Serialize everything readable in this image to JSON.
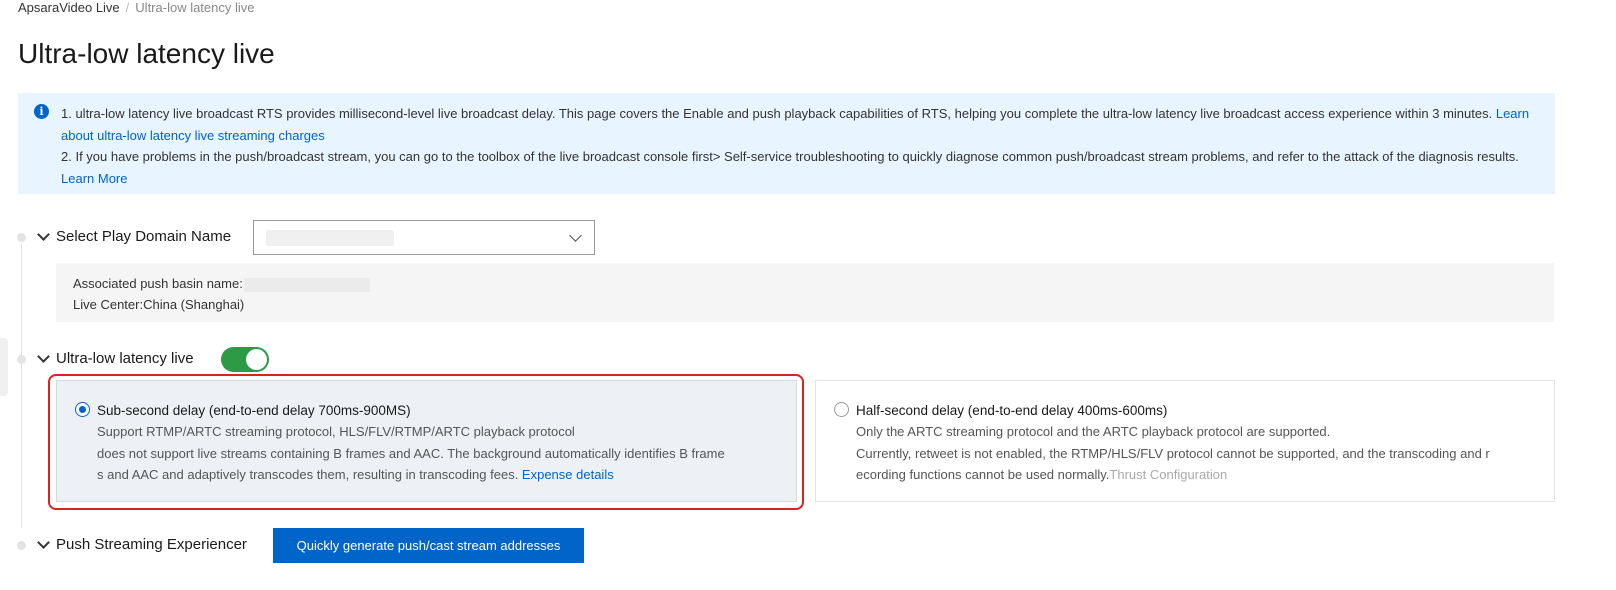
{
  "breadcrumb": {
    "root": "ApsaraVideo Live",
    "separator": "/",
    "current": "Ultra-low latency live"
  },
  "page_title": "Ultra-low latency live",
  "notice": {
    "line1": "1. ultra-low latency live broadcast RTS provides millisecond-level live broadcast delay. This page covers the Enable and push playback capabilities of RTS, helping you complete the ultra-low latency live broadcast access experience within 3 minutes. ",
    "line1_link": "Learn about ultra-low latency live streaming charges",
    "line2": "2. If you have problems in the push/broadcast stream, you can go to the toolbox of the live broadcast console first> Self-service troubleshooting to quickly diagnose common push/broadcast stream problems, and refer to the attack of the diagnosis results. ",
    "line2_link": "Learn More"
  },
  "domain_section": {
    "label": "Select Play Domain Name",
    "associated_label": "Associated push basin name:",
    "live_center": "Live Center:China (Shanghai)"
  },
  "latency_section": {
    "label": "Ultra-low latency live",
    "enabled": true,
    "options": [
      {
        "title": "Sub-second delay (end-to-end delay 700ms-900MS)",
        "desc1": "Support RTMP/ARTC streaming protocol, HLS/FLV/RTMP/ARTC playback protocol",
        "desc2": "does not support live streams containing B frames and AAC. The background automatically identifies B frame",
        "desc3": "s and AAC and adaptively transcodes them, resulting in transcoding fees. ",
        "link": "Expense details",
        "selected": true
      },
      {
        "title": "Half-second delay (end-to-end delay 400ms-600ms)",
        "desc1": "Only the ARTC streaming protocol and the ARTC playback protocol are supported.",
        "desc2": "Currently, retweet is not enabled, the RTMP/HLS/FLV protocol cannot be supported, and the transcoding and r",
        "desc3": "ecording functions cannot be used normally.",
        "link": "Thrust Configuration",
        "selected": false
      }
    ]
  },
  "push_section": {
    "label": "Push Streaming Experiencer",
    "button": "Quickly generate push/cast stream addresses"
  },
  "colors": {
    "primary": "#0064c8",
    "toggle_on": "#2d9b45",
    "highlight": "#e02020",
    "notice_bg": "#e8f4ff"
  }
}
